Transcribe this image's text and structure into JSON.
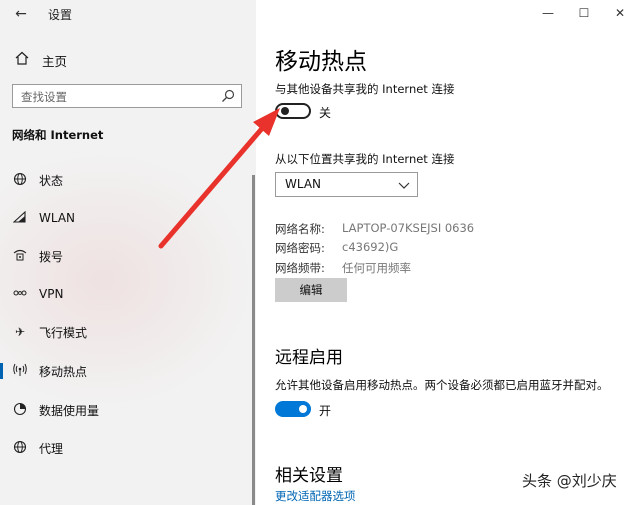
{
  "window": {
    "back_icon": "back-arrow-icon",
    "title": "设置",
    "minimize_symbol": "—",
    "maximize_symbol": "☐",
    "close_symbol": "✕"
  },
  "sidebar": {
    "home_label": "主页",
    "search_placeholder": "查找设置",
    "section_title": "网络和 Internet",
    "items": [
      {
        "label": "状态",
        "icon": "globe-icon"
      },
      {
        "label": "WLAN",
        "icon": "wifi-icon"
      },
      {
        "label": "拨号",
        "icon": "dialup-icon"
      },
      {
        "label": "VPN",
        "icon": "vpn-icon"
      },
      {
        "label": "飞行模式",
        "icon": "airplane-icon"
      },
      {
        "label": "移动热点",
        "icon": "hotspot-icon",
        "active": true
      },
      {
        "label": "数据使用量",
        "icon": "data-usage-icon"
      },
      {
        "label": "代理",
        "icon": "globe-icon"
      }
    ]
  },
  "main": {
    "title": "移动热点",
    "share_label": "与其他设备共享我的 Internet 连接",
    "share_toggle_state": "关",
    "from_label": "从以下位置共享我的 Internet 连接",
    "connection_selected": "WLAN",
    "network_name_label": "网络名称:",
    "network_name_value": "LAPTOP-07KSEJSI 0636",
    "network_password_label": "网络密码:",
    "network_password_value": "c43692)G",
    "network_band_label": "网络频带:",
    "network_band_value": "任何可用频率",
    "edit_button": "编辑",
    "remote_title": "远程启用",
    "remote_desc": "允许其他设备启用移动热点。两个设备必须都已启用蓝牙并配对。",
    "remote_toggle_state": "开",
    "related_title": "相关设置",
    "related_link": "更改适配器选项"
  },
  "annotation": {
    "color": "#e8322b"
  },
  "watermark": "头条 @刘少庆"
}
